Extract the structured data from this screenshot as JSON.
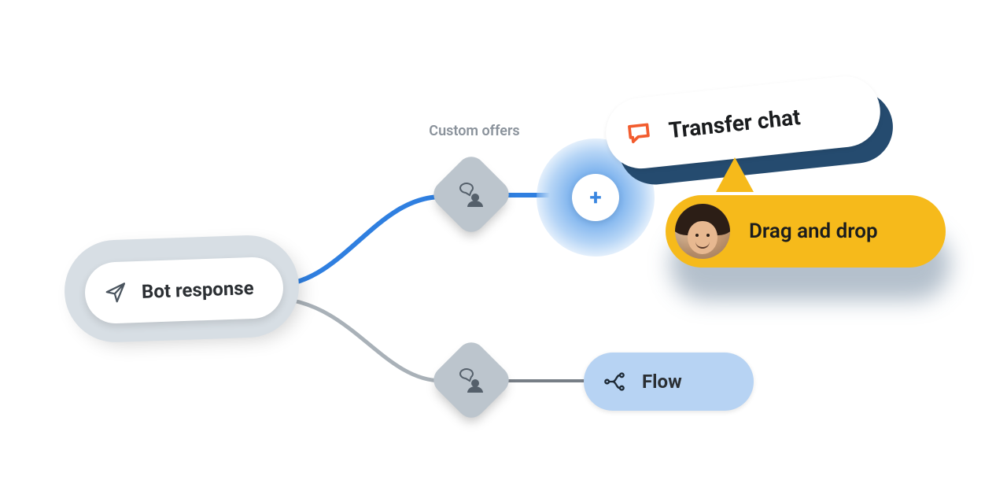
{
  "nodes": {
    "bot_response": {
      "label": "Bot response"
    },
    "decision_top": {
      "label": "Custom offers"
    },
    "add_node": {
      "symbol": "+"
    },
    "transfer_chat": {
      "label": "Transfer chat"
    },
    "drag_hint": {
      "label": "Drag and drop"
    },
    "flow": {
      "label": "Flow"
    }
  },
  "icons": {
    "send": "paper-plane",
    "talk_to_agent": "chat-person",
    "chat_bubble": "chat-bubble-outline",
    "branch": "flow-branch"
  },
  "colors": {
    "active_edge": "#2F7FE0",
    "inactive_edge": "#A9B1B8",
    "halo": "#D7DEE4",
    "diamond": "#BCC5CD",
    "yellow": "#F6BA1B",
    "orange": "#F25C2E",
    "navy_shadow": "#254B6F",
    "light_blue_fill": "#B7D3F3"
  }
}
